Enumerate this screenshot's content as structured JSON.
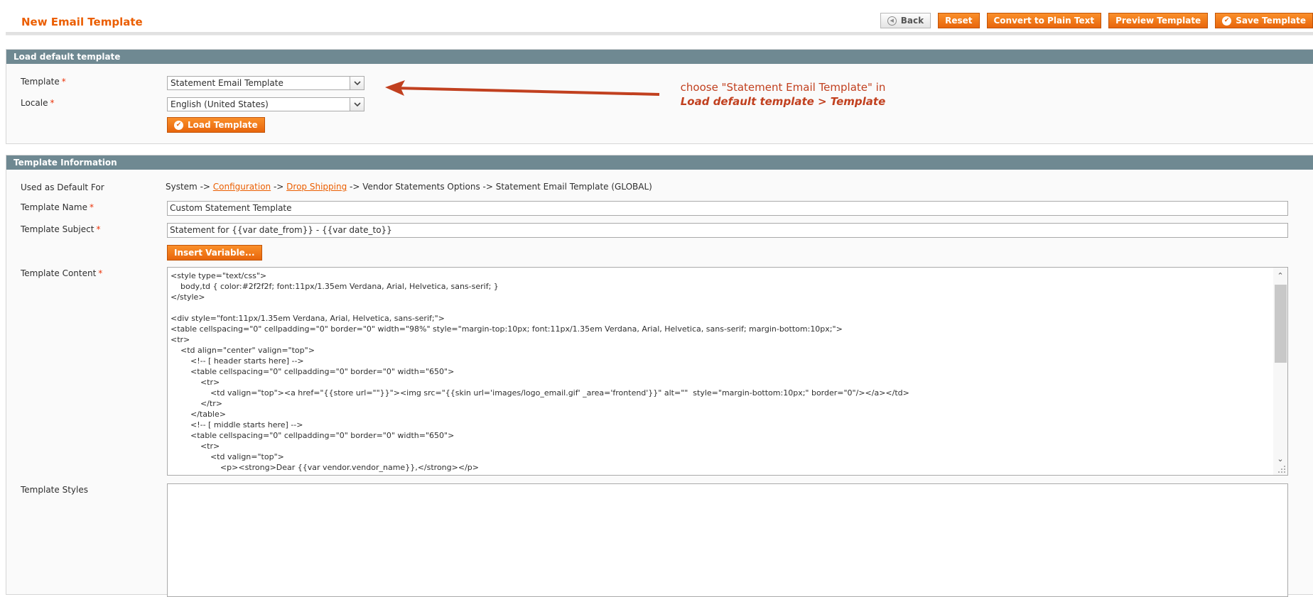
{
  "header": {
    "title": "New Email Template",
    "buttons": {
      "back": "Back",
      "reset": "Reset",
      "convert": "Convert to Plain Text",
      "preview": "Preview Template",
      "save": "Save Template"
    }
  },
  "load_section": {
    "title": "Load default template",
    "template_label": "Template",
    "template_value": "Statement Email Template",
    "locale_label": "Locale",
    "locale_value": "English (United States)",
    "load_button": "Load Template",
    "required_mark": "*"
  },
  "annotation": {
    "line1": "choose \"Statement Email Template\" in",
    "line2": "Load default template > Template",
    "color": "#c1401f"
  },
  "info_section": {
    "title": "Template Information",
    "used_as_default_label": "Used as Default For",
    "path": {
      "prefix": "System -> ",
      "link1": "Configuration",
      "sep1": " -> ",
      "link2": "Drop Shipping",
      "suffix": " -> Vendor Statements Options -> Statement Email Template  (GLOBAL)"
    },
    "name_label": "Template Name",
    "name_value": "Custom Statement Template",
    "subject_label": "Template Subject",
    "subject_value": "Statement for {{var date_from}} - {{var date_to}}",
    "insert_variable_button": "Insert Variable...",
    "content_label": "Template Content",
    "content_value": "<style type=\"text/css\">\n    body,td { color:#2f2f2f; font:11px/1.35em Verdana, Arial, Helvetica, sans-serif; }\n</style>\n\n<div style=\"font:11px/1.35em Verdana, Arial, Helvetica, sans-serif;\">\n<table cellspacing=\"0\" cellpadding=\"0\" border=\"0\" width=\"98%\" style=\"margin-top:10px; font:11px/1.35em Verdana, Arial, Helvetica, sans-serif; margin-bottom:10px;\">\n<tr>\n    <td align=\"center\" valign=\"top\">\n        <!-- [ header starts here] -->\n        <table cellspacing=\"0\" cellpadding=\"0\" border=\"0\" width=\"650\">\n            <tr>\n                <td valign=\"top\"><a href=\"{{store url=\"\"}}\"><img src=\"{{skin url='images/logo_email.gif' _area='frontend'}}\" alt=\"\"  style=\"margin-bottom:10px;\" border=\"0\"/></a></td>\n            </tr>\n        </table>\n        <!-- [ middle starts here] -->\n        <table cellspacing=\"0\" cellpadding=\"0\" border=\"0\" width=\"650\">\n            <tr>\n                <td valign=\"top\">\n                    <p><strong>Dear {{var vendor.vendor_name}},</strong></p>",
    "styles_label": "Template Styles",
    "styles_value": ""
  },
  "colors": {
    "accent": "#eb5e00",
    "section_header": "#6f8992",
    "button": "#f18200"
  }
}
